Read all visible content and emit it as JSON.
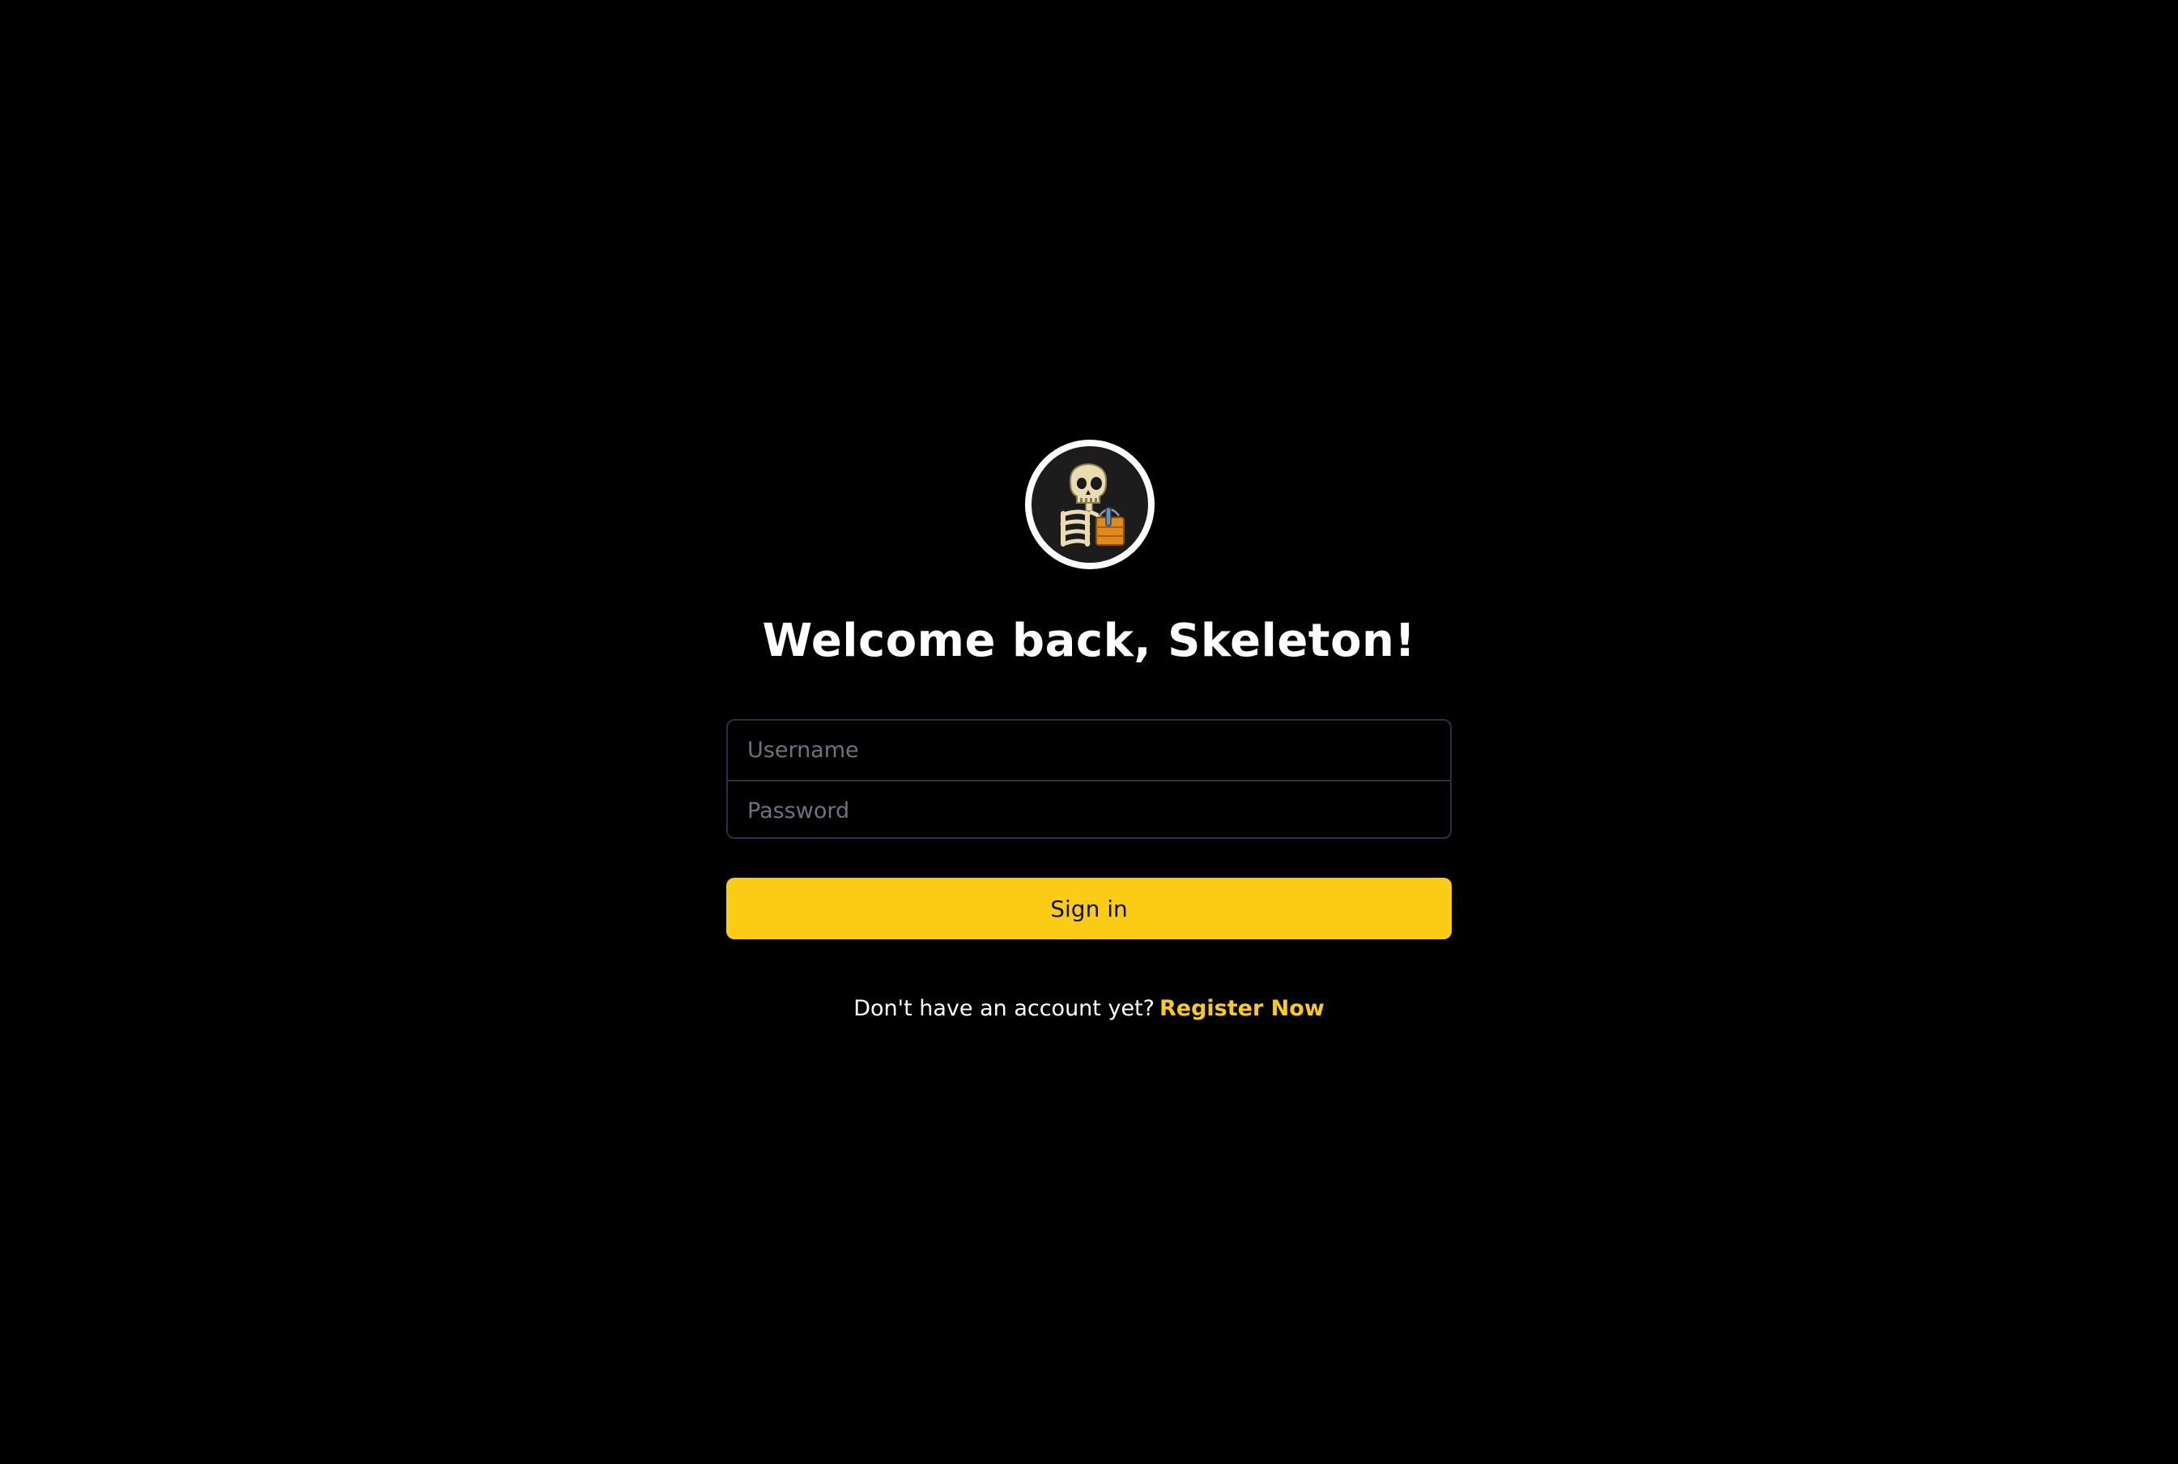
{
  "page": {
    "background": "#000000",
    "accent": "#facc15"
  },
  "avatar": {
    "icon": "skeleton-with-basket-icon"
  },
  "login": {
    "title": "Welcome back, Skeleton!",
    "username_placeholder": "Username",
    "password_placeholder": "Password",
    "signin_label": "Sign in",
    "register_prompt": "Don't have an account yet?",
    "register_link": "Register Now"
  }
}
